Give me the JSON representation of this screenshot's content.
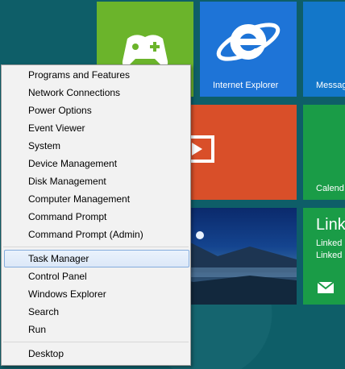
{
  "tiles": {
    "xbox": {
      "icon": "xbox-controller-icon"
    },
    "internet_explorer": {
      "label": "Internet Explorer",
      "icon": "internet-explorer-icon"
    },
    "messaging": {
      "label": "Messag"
    },
    "video": {
      "icon": "video-play-icon"
    },
    "calendar": {
      "label": "Calend"
    },
    "photos": {},
    "linkedin": {
      "title": "Link",
      "line1": "Linked",
      "line2": "Linked",
      "icon": "mail-envelope-icon"
    }
  },
  "menu": {
    "group1": [
      "Programs and Features",
      "Network Connections",
      "Power Options",
      "Event Viewer",
      "System",
      "Device Management",
      "Disk Management",
      "Computer Management",
      "Command Prompt",
      "Command Prompt (Admin)"
    ],
    "group2": [
      "Task Manager",
      "Control Panel",
      "Windows Explorer",
      "Search",
      "Run"
    ],
    "group3": [
      "Desktop"
    ],
    "highlighted_item": "Task Manager"
  },
  "colors": {
    "background": "#0e5e68",
    "tile_green": "#6bb42b",
    "tile_blue": "#1e74d7",
    "tile_orange": "#d94f29",
    "tile_dark_green": "#1a9c47",
    "menu_bg": "#f2f2f2",
    "menu_highlight_border": "#84acdd"
  }
}
